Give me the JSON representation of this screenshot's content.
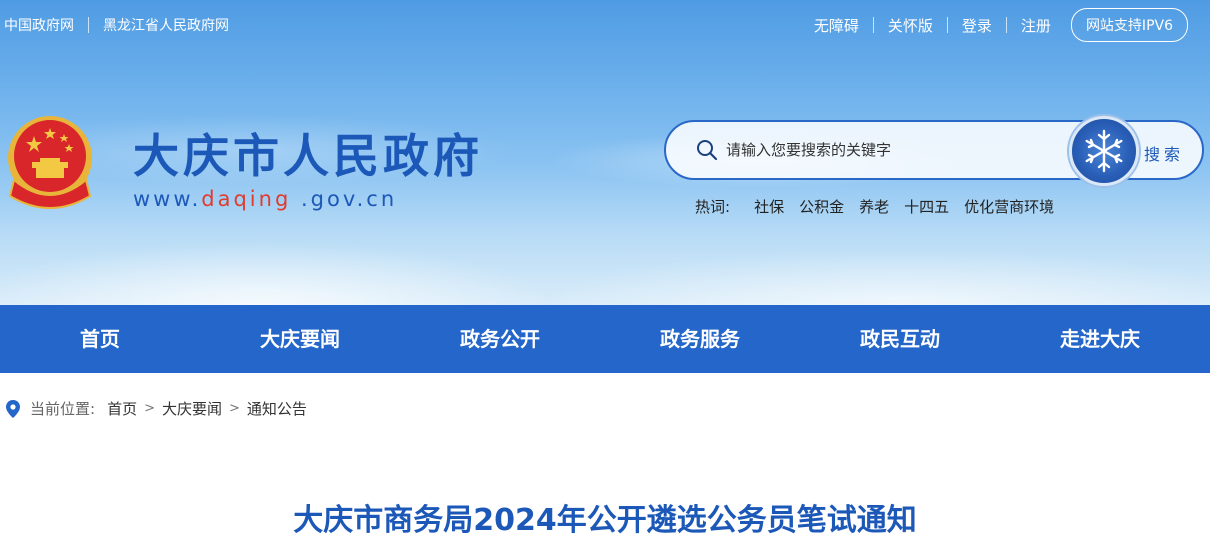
{
  "top_links_left": [
    "中国政府网",
    "黑龙江省人民政府网"
  ],
  "top_links_right": [
    "无障碍",
    "关怀版",
    "登录",
    "注册"
  ],
  "ipv6_label": "网站支持IPV6",
  "site": {
    "title": "大庆市人民政府",
    "url_prefix": "www.",
    "url_highlight": "daqing",
    "url_suffix": " .gov.cn"
  },
  "search": {
    "placeholder": "请输入您要搜索的关键字",
    "button_label": "搜索"
  },
  "hot_words": {
    "label": "热词:",
    "items": [
      "社保",
      "公积金",
      "养老",
      "十四五",
      "优化营商环境"
    ]
  },
  "nav": [
    "首页",
    "大庆要闻",
    "政务公开",
    "政务服务",
    "政民互动",
    "走进大庆"
  ],
  "breadcrumb": {
    "label": "当前位置:",
    "items": [
      "首页",
      "大庆要闻",
      "通知公告"
    ],
    "separator": ">"
  },
  "article": {
    "title": "大庆市商务局2024年公开遴选公务员笔试通知"
  },
  "colors": {
    "brand_blue": "#2466c9",
    "title_blue": "#1c58b8",
    "url_red": "#e03c2e"
  }
}
